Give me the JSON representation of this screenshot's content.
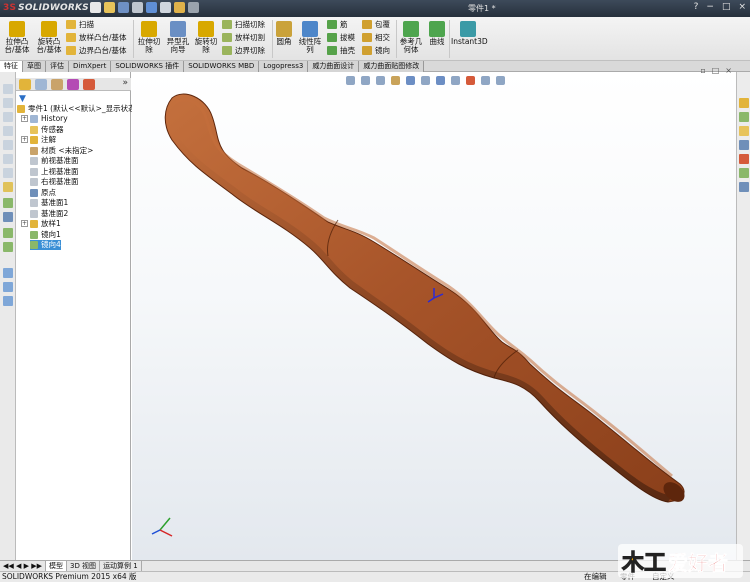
{
  "app": {
    "logo_text": "SOLIDWORKS",
    "document_title": "零件1 *",
    "window_buttons": [
      "?",
      "−",
      "□",
      "×"
    ]
  },
  "ribbon": {
    "large_buttons": [
      {
        "label": "拉伸凸\n台/基体",
        "icon": "extrude-boss-icon",
        "color": "#d8a800"
      },
      {
        "label": "旋转凸\n台/基体",
        "icon": "revolve-boss-icon",
        "color": "#d8a800"
      },
      {
        "label": "拉伸切\n除",
        "icon": "extrude-cut-icon",
        "color": "#d8a800"
      },
      {
        "label": "异型孔\n向导",
        "icon": "hole-wizard-icon",
        "color": "#6a8fc4"
      },
      {
        "label": "旋转切\n除",
        "icon": "revolve-cut-icon",
        "color": "#d8a800"
      },
      {
        "label": "圆角",
        "icon": "fillet-icon",
        "color": "#caa23a"
      },
      {
        "label": "线性阵\n列",
        "icon": "linear-pattern-icon",
        "color": "#4d86c9"
      },
      {
        "label": "参考几\n何体",
        "icon": "reference-geometry-icon",
        "color": "#4ea54e"
      },
      {
        "label": "曲线",
        "icon": "curves-icon",
        "color": "#4ea54e"
      },
      {
        "label": "Instant3D",
        "icon": "instant3d-icon",
        "color": "#3b9aa6"
      }
    ],
    "small_buttons": [
      {
        "label": "扫描",
        "icon": "sweep-icon"
      },
      {
        "label": "放样凸台/基体",
        "icon": "loft-icon"
      },
      {
        "label": "边界凸台/基体",
        "icon": "boundary-boss-icon"
      },
      {
        "label": "扫描切除",
        "icon": "swept-cut-icon"
      },
      {
        "label": "放样切割",
        "icon": "lofted-cut-icon"
      },
      {
        "label": "边界切除",
        "icon": "boundary-cut-icon"
      },
      {
        "label": "筋",
        "icon": "rib-icon"
      },
      {
        "label": "拔模",
        "icon": "draft-icon"
      },
      {
        "label": "抽壳",
        "icon": "shell-icon"
      },
      {
        "label": "包覆",
        "icon": "wrap-icon"
      },
      {
        "label": "相交",
        "icon": "intersect-icon"
      },
      {
        "label": "镜向",
        "icon": "mirror-icon"
      }
    ]
  },
  "command_tabs": [
    {
      "label": "特征",
      "active": true
    },
    {
      "label": "草图",
      "active": false
    },
    {
      "label": "评估",
      "active": false
    },
    {
      "label": "DimXpert",
      "active": false
    },
    {
      "label": "SOLIDWORKS 插件",
      "active": false
    },
    {
      "label": "SOLIDWORKS MBD",
      "active": false
    },
    {
      "label": "Logopress3",
      "active": false
    },
    {
      "label": "威力曲面设计",
      "active": false
    },
    {
      "label": "威力曲面贴图修改",
      "active": false
    }
  ],
  "feature_tree": {
    "more_symbol": "»",
    "filter_symbol": "▼",
    "root": "零件1 (默认<<默认>_显示状态",
    "items": [
      {
        "label": "History",
        "icon": "history-icon",
        "expand": "+",
        "selected": false
      },
      {
        "label": "传感器",
        "icon": "sensor-icon",
        "expand": "",
        "selected": false
      },
      {
        "label": "注解",
        "icon": "annotations-icon",
        "expand": "+",
        "selected": false
      },
      {
        "label": "材质 <未指定>",
        "icon": "material-icon",
        "expand": "",
        "selected": false
      },
      {
        "label": "前视基准面",
        "icon": "plane-icon",
        "expand": "",
        "selected": false
      },
      {
        "label": "上视基准面",
        "icon": "plane-icon",
        "expand": "",
        "selected": false
      },
      {
        "label": "右视基准面",
        "icon": "plane-icon",
        "expand": "",
        "selected": false
      },
      {
        "label": "原点",
        "icon": "origin-icon",
        "expand": "",
        "selected": false
      },
      {
        "label": "基准面1",
        "icon": "plane-icon",
        "expand": "",
        "selected": false
      },
      {
        "label": "基准面2",
        "icon": "plane-icon",
        "expand": "",
        "selected": false
      },
      {
        "label": "放样1",
        "icon": "loft-feature-icon",
        "expand": "+",
        "selected": false
      },
      {
        "label": "镜向1",
        "icon": "mirror-feature-icon",
        "expand": "",
        "selected": false
      },
      {
        "label": "镜向4",
        "icon": "mirror-feature-icon",
        "expand": "",
        "selected": true
      }
    ]
  },
  "bottom_tabs": [
    {
      "label": "◀◀ ◀ ▶ ▶▶",
      "active": false
    },
    {
      "label": "模型",
      "active": true
    },
    {
      "label": "3D 视图",
      "active": false
    },
    {
      "label": "运动算例 1",
      "active": false
    }
  ],
  "status": {
    "product": "SOLIDWORKS Premium 2015 x64 版",
    "state": "在编辑",
    "doc": "零件",
    "units": "自定义"
  },
  "model": {
    "wood_light": "#a8552a",
    "wood_mid": "#8a3f1a",
    "wood_dark": "#5e260c",
    "highlight": "#c4703d"
  },
  "watermark": {
    "text_left": "木工",
    "text_right": "爱好者"
  }
}
